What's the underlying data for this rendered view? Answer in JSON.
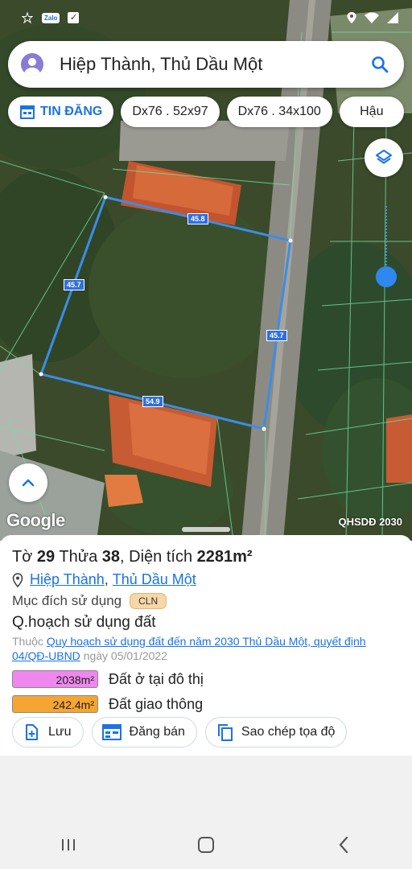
{
  "status_bar": {
    "time": "",
    "notif_zalo": "Zalo",
    "icons": [
      "zalo-icon",
      "check-icon",
      "location-icon",
      "wifi-icon",
      "signal-icon"
    ]
  },
  "search": {
    "query": "Hiệp Thành, Thủ Dầu Một",
    "icon": "search-icon"
  },
  "chips": [
    {
      "label": "TIN ĐĂNG",
      "icon": "calendar-icon"
    },
    {
      "label": "Dx76 . 52x97"
    },
    {
      "label": "Dx76 . 34x100"
    },
    {
      "label": "Hậu"
    }
  ],
  "map": {
    "edges": [
      "45.8",
      "45.7",
      "45.7",
      "54.9"
    ],
    "google": "Google",
    "plan_tag": "QHSDĐ 2030"
  },
  "parcel": {
    "to_label": "Tờ",
    "to_value": "29",
    "thua_label": "Thửa",
    "thua_value": "38",
    "area_label": "Diện tích",
    "area_value": "2281m²",
    "ward": "Hiệp Thành",
    "city": "Thủ Dầu Một",
    "purpose_label": "Mục đích sử dụng",
    "purpose_code": "CLN",
    "plan_title": "Q.hoạch sử dụng đất",
    "source_prefix": "Thuộc",
    "source_link": "Quy hoạch sử dụng đất đến năm 2030 Thủ Dầu Một, quyết định 04/QĐ-UBND",
    "source_date": "ngày 05/01/2022",
    "zones": [
      {
        "value": "2038m²",
        "label": "Đất ở tại đô thị",
        "color": "#ee88ee"
      },
      {
        "value": "242.4m²",
        "label": "Đất giao thông",
        "color": "#f5a531"
      }
    ]
  },
  "actions": [
    {
      "label": "Lưu",
      "icon": "add-file-icon"
    },
    {
      "label": "Đăng bán",
      "icon": "calendar-grid-icon"
    },
    {
      "label": "Sao chép tọa độ",
      "icon": "copy-icon"
    }
  ],
  "colors": {
    "accent": "#1a73e8",
    "boundary": "#3a8de8"
  }
}
